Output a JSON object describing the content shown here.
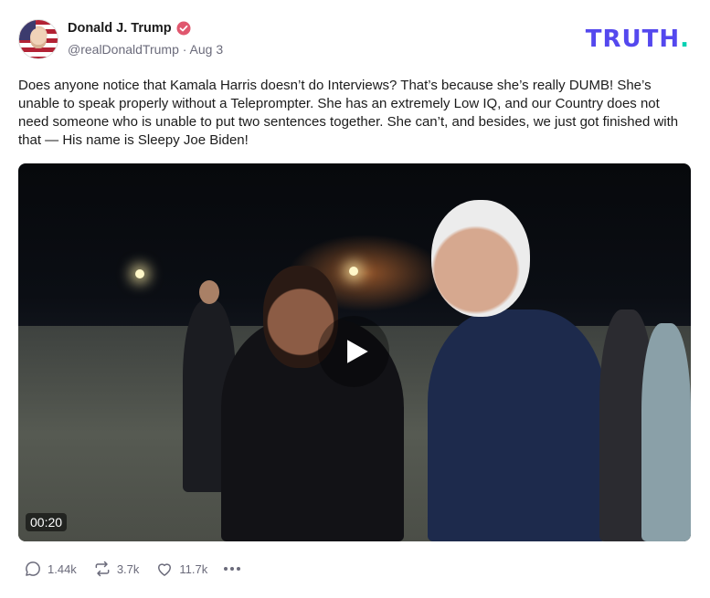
{
  "author": {
    "display_name": "Donald J. Trump",
    "handle": "@realDonaldTrump",
    "separator": "·",
    "date": "Aug 3"
  },
  "brand": {
    "logo_text": "TRUTH",
    "logo_dot": "."
  },
  "post": {
    "text": "Does anyone notice that Kamala Harris doesn’t do Interviews? That’s because she’s really DUMB! She’s unable to speak properly without a Teleprompter. She has an extremely Low IQ, and our Country does not need someone who is unable to put two sentences together. She can’t, and besides, we just got finished with that — His name is Sleepy Joe Biden!"
  },
  "video": {
    "duration": "00:20"
  },
  "actions": {
    "replies": "1.44k",
    "retruths": "3.7k",
    "likes": "11.7k"
  },
  "colors": {
    "brand": "#5448ee",
    "brand_dot": "#00d1b2",
    "verified": "#e0576e",
    "muted": "#6b6b7b"
  },
  "icons": [
    "verified-badge-icon",
    "play-icon",
    "reply-icon",
    "retruth-icon",
    "like-icon",
    "more-icon"
  ]
}
